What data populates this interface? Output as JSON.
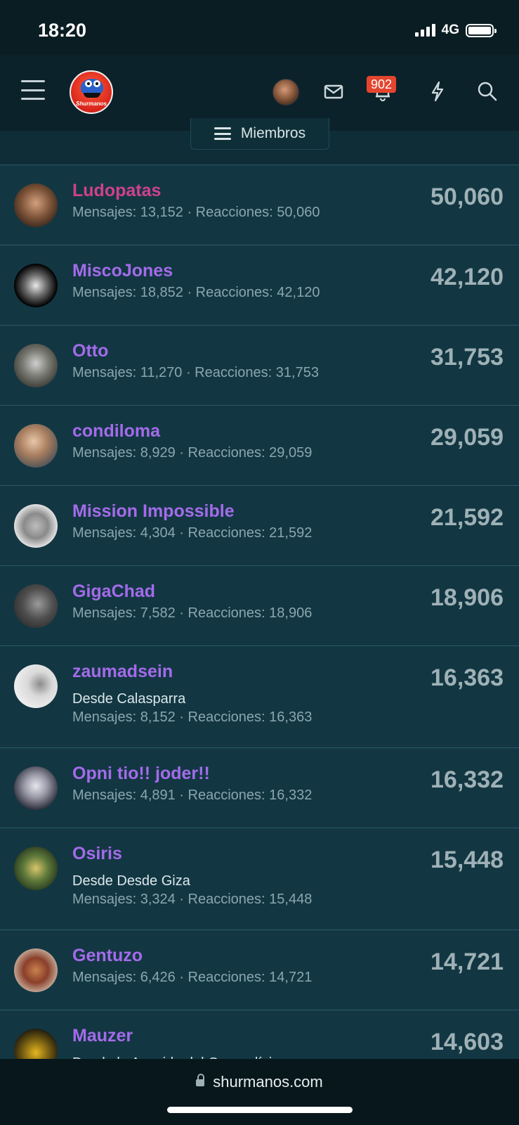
{
  "status_bar": {
    "time": "18:20",
    "network": "4G"
  },
  "header": {
    "logo_text": "Shurmanos",
    "notification_count": "902"
  },
  "subtab": {
    "label": "Miembros"
  },
  "members": [
    {
      "name": "Ludopatas",
      "location": "",
      "stats": "Mensajes: 13,152 · Reacciones: 50,060",
      "count": "50,060",
      "name_color": "#d0418d"
    },
    {
      "name": "MiscoJones",
      "location": "",
      "stats": "Mensajes: 18,852 · Reacciones: 42,120",
      "count": "42,120",
      "name_color": "#a46bea"
    },
    {
      "name": "Otto",
      "location": "",
      "stats": "Mensajes: 11,270 · Reacciones: 31,753",
      "count": "31,753",
      "name_color": "#a46bea"
    },
    {
      "name": "condiloma",
      "location": "",
      "stats": "Mensajes: 8,929 · Reacciones: 29,059",
      "count": "29,059",
      "name_color": "#a46bea"
    },
    {
      "name": "Mission Impossible",
      "location": "",
      "stats": "Mensajes: 4,304 · Reacciones: 21,592",
      "count": "21,592",
      "name_color": "#a46bea"
    },
    {
      "name": "GigaChad",
      "location": "",
      "stats": "Mensajes: 7,582 · Reacciones: 18,906",
      "count": "18,906",
      "name_color": "#a46bea"
    },
    {
      "name": "zaumadsein",
      "location": "Desde Calasparra",
      "stats": "Mensajes: 8,152 · Reacciones: 16,363",
      "count": "16,363",
      "name_color": "#a46bea"
    },
    {
      "name": "Opni tio!! joder!!",
      "location": "",
      "stats": "Mensajes: 4,891 · Reacciones: 16,332",
      "count": "16,332",
      "name_color": "#a46bea"
    },
    {
      "name": "Osiris",
      "location": "Desde Desde Giza",
      "stats": "Mensajes: 3,324 · Reacciones: 15,448",
      "count": "15,448",
      "name_color": "#a46bea"
    },
    {
      "name": "Gentuzo",
      "location": "",
      "stats": "Mensajes: 6,426 · Reacciones: 14,721",
      "count": "14,721",
      "name_color": "#a46bea"
    },
    {
      "name": "Mauzer",
      "location": "Desde la Avenida del Generalísimo",
      "stats": "",
      "count": "14,603",
      "name_color": "#a46bea"
    }
  ],
  "bottom": {
    "url": "shurmanos.com"
  },
  "colors": {
    "background": "#0f2d36",
    "name_default": "#a46bea",
    "name_admin": "#d0418d",
    "badge": "#e5452f"
  }
}
